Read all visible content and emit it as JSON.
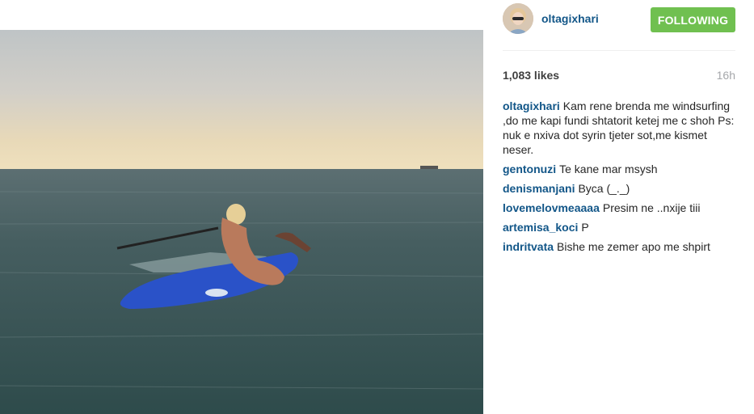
{
  "post": {
    "image_alt": "Woman on a blue windsurf board in the sea at sunset"
  },
  "header": {
    "username": "oltagixhari",
    "follow_label": "FOLLOWING"
  },
  "stats": {
    "likes": "1,083 likes",
    "time": "16h"
  },
  "comments": [
    {
      "author": "oltagixhari",
      "text": "Kam rene brenda me windsurfing ,do me kapi fundi shtatorit ketej me c shoh Ps: nuk e nxiva dot syrin tjeter sot,me kismet neser."
    },
    {
      "author": "gentonuzi",
      "text": "Te kane mar msysh"
    },
    {
      "author": "denismanjani",
      "text": "Byca (_._)"
    },
    {
      "author": "lovemelovmeaaaa",
      "text": "Presim ne ..nxije tiii"
    },
    {
      "author": "artemisa_koci",
      "text": "P"
    },
    {
      "author": "indritvata",
      "text": "Bishe me zemer apo me shpirt"
    }
  ],
  "colors": {
    "link": "#125688",
    "follow_button": "#70c050",
    "sky_top": "#c9c7c2",
    "sea": "#3a5657",
    "board": "#2a52c8"
  }
}
